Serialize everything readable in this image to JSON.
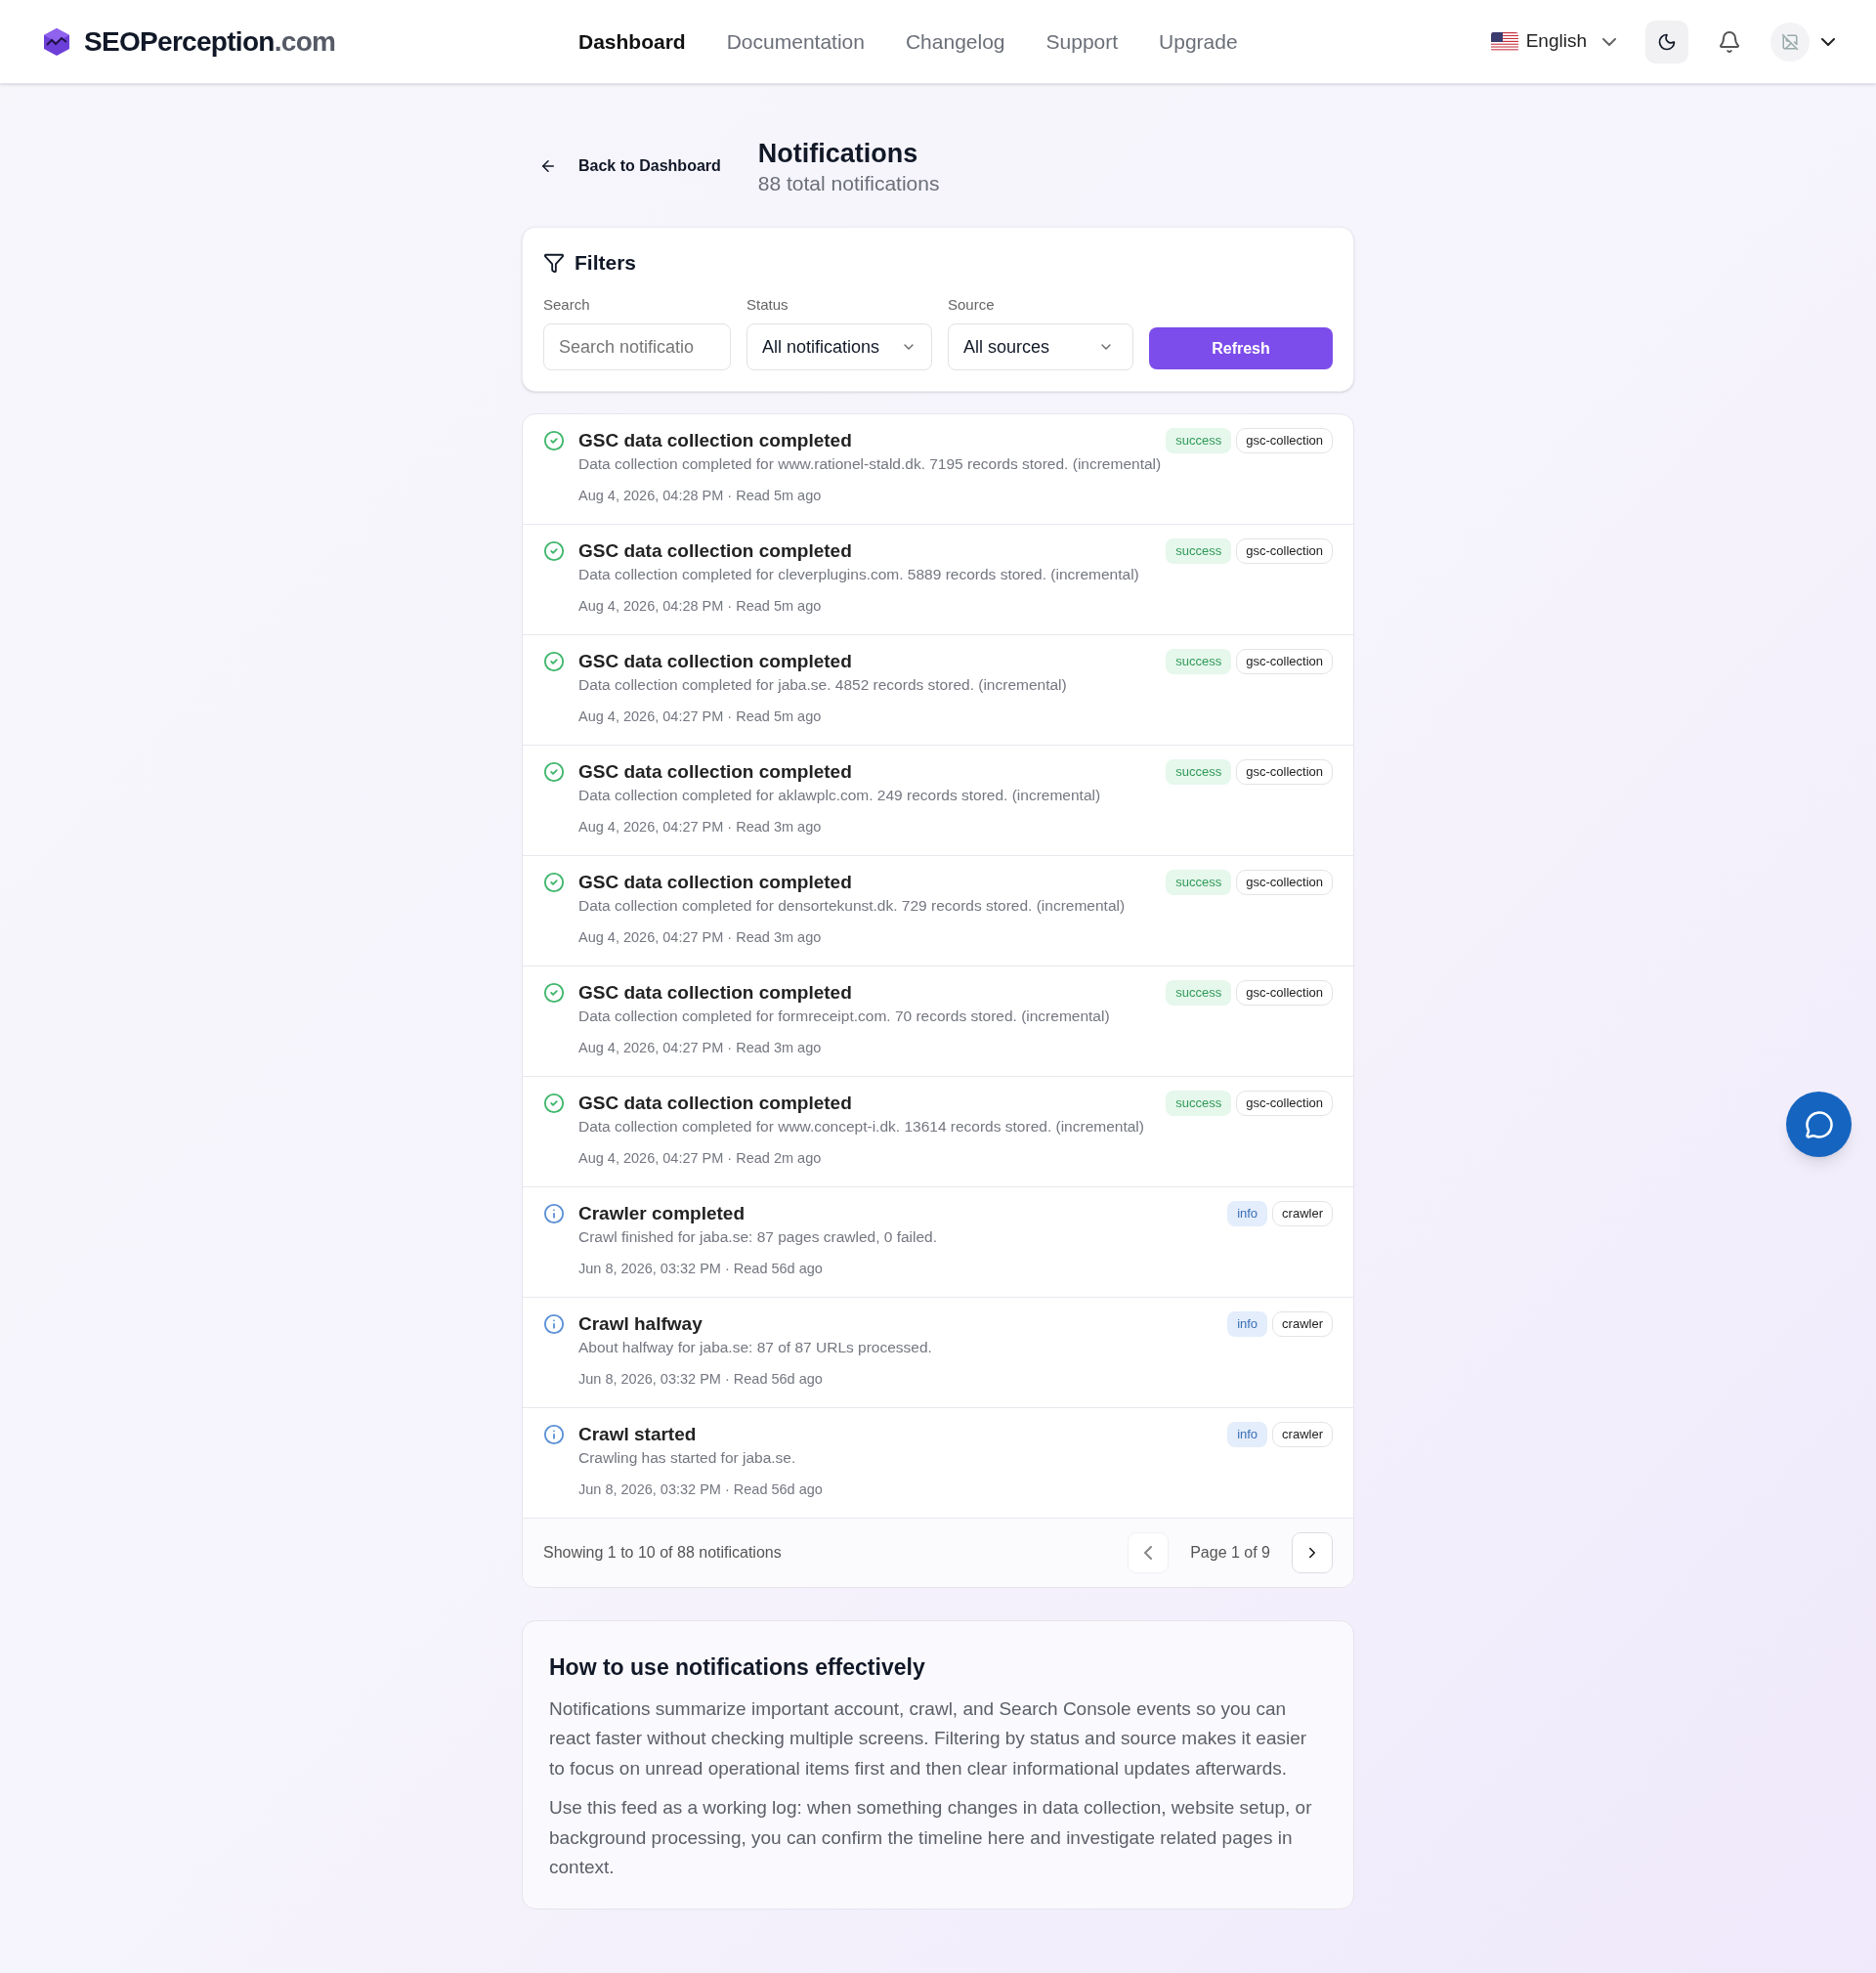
{
  "brand": {
    "name": "SEOPerception",
    "suffix": ".com"
  },
  "nav": [
    {
      "label": "Dashboard",
      "selected": true
    },
    {
      "label": "Documentation",
      "selected": false
    },
    {
      "label": "Changelog",
      "selected": false
    },
    {
      "label": "Support",
      "selected": false
    },
    {
      "label": "Upgrade",
      "selected": false
    }
  ],
  "language": "English",
  "back_link": "Back to Dashboard",
  "page": {
    "title": "Notifications",
    "subtitle": "88 total notifications"
  },
  "filters": {
    "title": "Filters",
    "search": {
      "label": "Search",
      "placeholder": "Search notificatio"
    },
    "status": {
      "label": "Status",
      "value": "All notifications"
    },
    "source": {
      "label": "Source",
      "value": "All sources"
    },
    "refresh": "Refresh"
  },
  "notifications": [
    {
      "kind": "success",
      "title": "GSC data collection completed",
      "message": "Data collection completed for www.rationel-stald.dk. 7195 records stored. (incremental)",
      "meta": "Aug 4, 2026, 04:28 PM · Read 5m ago",
      "status": "success",
      "source": "gsc-collection"
    },
    {
      "kind": "success",
      "title": "GSC data collection completed",
      "message": "Data collection completed for cleverplugins.com. 5889 records stored. (incremental)",
      "meta": "Aug 4, 2026, 04:28 PM · Read 5m ago",
      "status": "success",
      "source": "gsc-collection"
    },
    {
      "kind": "success",
      "title": "GSC data collection completed",
      "message": "Data collection completed for jaba.se. 4852 records stored. (incremental)",
      "meta": "Aug 4, 2026, 04:27 PM · Read 5m ago",
      "status": "success",
      "source": "gsc-collection"
    },
    {
      "kind": "success",
      "title": "GSC data collection completed",
      "message": "Data collection completed for aklawplc.com. 249 records stored. (incremental)",
      "meta": "Aug 4, 2026, 04:27 PM · Read 3m ago",
      "status": "success",
      "source": "gsc-collection"
    },
    {
      "kind": "success",
      "title": "GSC data collection completed",
      "message": "Data collection completed for densortekunst.dk. 729 records stored. (incremental)",
      "meta": "Aug 4, 2026, 04:27 PM · Read 3m ago",
      "status": "success",
      "source": "gsc-collection"
    },
    {
      "kind": "success",
      "title": "GSC data collection completed",
      "message": "Data collection completed for formreceipt.com. 70 records stored. (incremental)",
      "meta": "Aug 4, 2026, 04:27 PM · Read 3m ago",
      "status": "success",
      "source": "gsc-collection"
    },
    {
      "kind": "success",
      "title": "GSC data collection completed",
      "message": "Data collection completed for www.concept-i.dk. 13614 records stored. (incremental)",
      "meta": "Aug 4, 2026, 04:27 PM · Read 2m ago",
      "status": "success",
      "source": "gsc-collection"
    },
    {
      "kind": "info",
      "title": "Crawler completed",
      "message": "Crawl finished for jaba.se: 87 pages crawled, 0 failed.",
      "meta": "Jun 8, 2026, 03:32 PM · Read 56d ago",
      "status": "info",
      "source": "crawler"
    },
    {
      "kind": "info",
      "title": "Crawl halfway",
      "message": "About halfway for jaba.se: 87 of 87 URLs processed.",
      "meta": "Jun 8, 2026, 03:32 PM · Read 56d ago",
      "status": "info",
      "source": "crawler"
    },
    {
      "kind": "info",
      "title": "Crawl started",
      "message": "Crawling has started for jaba.se.",
      "meta": "Jun 8, 2026, 03:32 PM · Read 56d ago",
      "status": "info",
      "source": "crawler"
    }
  ],
  "pagination": {
    "summary": "Showing 1 to 10 of 88 notifications",
    "page": "Page 1 of 9",
    "prev_disabled": true,
    "next_disabled": false
  },
  "help": {
    "title": "How to use notifications effectively",
    "paragraphs": [
      "Notifications summarize important account, crawl, and Search Console events so you can react faster without checking multiple screens. Filtering by status and source makes it easier to focus on unread operational items first and then clear informational updates afterwards.",
      "Use this feed as a working log: when something changes in data collection, website setup, or background processing, you can confirm the timeline here and investigate related pages in context."
    ]
  }
}
